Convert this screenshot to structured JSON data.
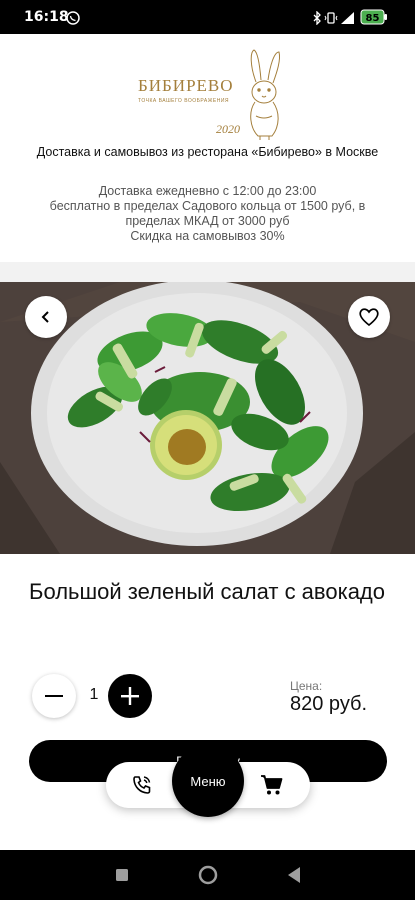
{
  "status_bar": {
    "time": "16:18",
    "battery": "85",
    "icons": [
      "whatsapp-icon",
      "bluetooth-icon",
      "vibrate-icon",
      "signal-icon",
      "battery-icon"
    ]
  },
  "header": {
    "logo": {
      "brand": "БИБИРЕВО",
      "tagline": "ТОЧКА ВАШЕГО ВООБРАЖЕНИЯ",
      "year": "2020"
    },
    "info_title": "Доставка и самовывоз из ресторана «Бибирево» в Москве",
    "info_lines": [
      "Доставка ежедневно с 12:00 до 23:00",
      "бесплатно в пределах Садового кольца от 1500 руб, в пределах МКАД от 3000 руб",
      "Скидка на самовывоз 30%"
    ]
  },
  "product": {
    "title": "Большой зеленый салат с авокадо",
    "quantity": "1",
    "price_label": "Цена:",
    "price": "820 руб."
  },
  "cart_button": {
    "label": "В корзину"
  },
  "bottom_nav": {
    "menu_label": "Меню",
    "phone_icon": "phone-call-icon",
    "cart_icon": "cart-icon"
  },
  "android_nav": {
    "buttons": [
      "recent-apps-icon",
      "home-icon",
      "back-icon"
    ]
  },
  "colors": {
    "accent": "#000000",
    "brand_gold": "#a47f3c",
    "plate": "#e6e6e6"
  }
}
